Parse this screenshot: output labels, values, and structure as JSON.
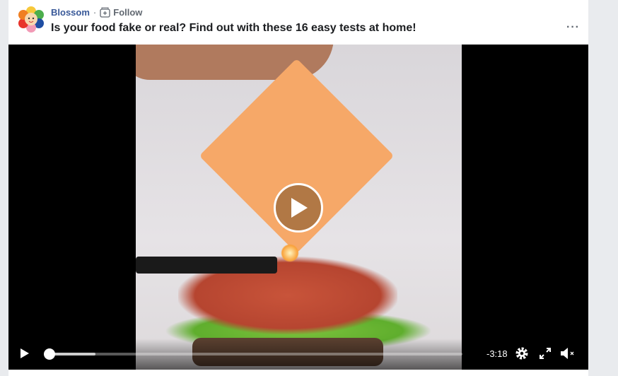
{
  "post": {
    "page_name": "Blossom",
    "separator": "·",
    "follow_label": "Follow",
    "title": "Is your food fake or real? Find out with these 16 easy tests at home!",
    "more_label": "···"
  },
  "video": {
    "time_remaining": "-3:18",
    "progress": 0.0,
    "buffered": 0.12,
    "muted": true
  },
  "colors": {
    "link": "#385898",
    "bg": "#e9ebee"
  }
}
